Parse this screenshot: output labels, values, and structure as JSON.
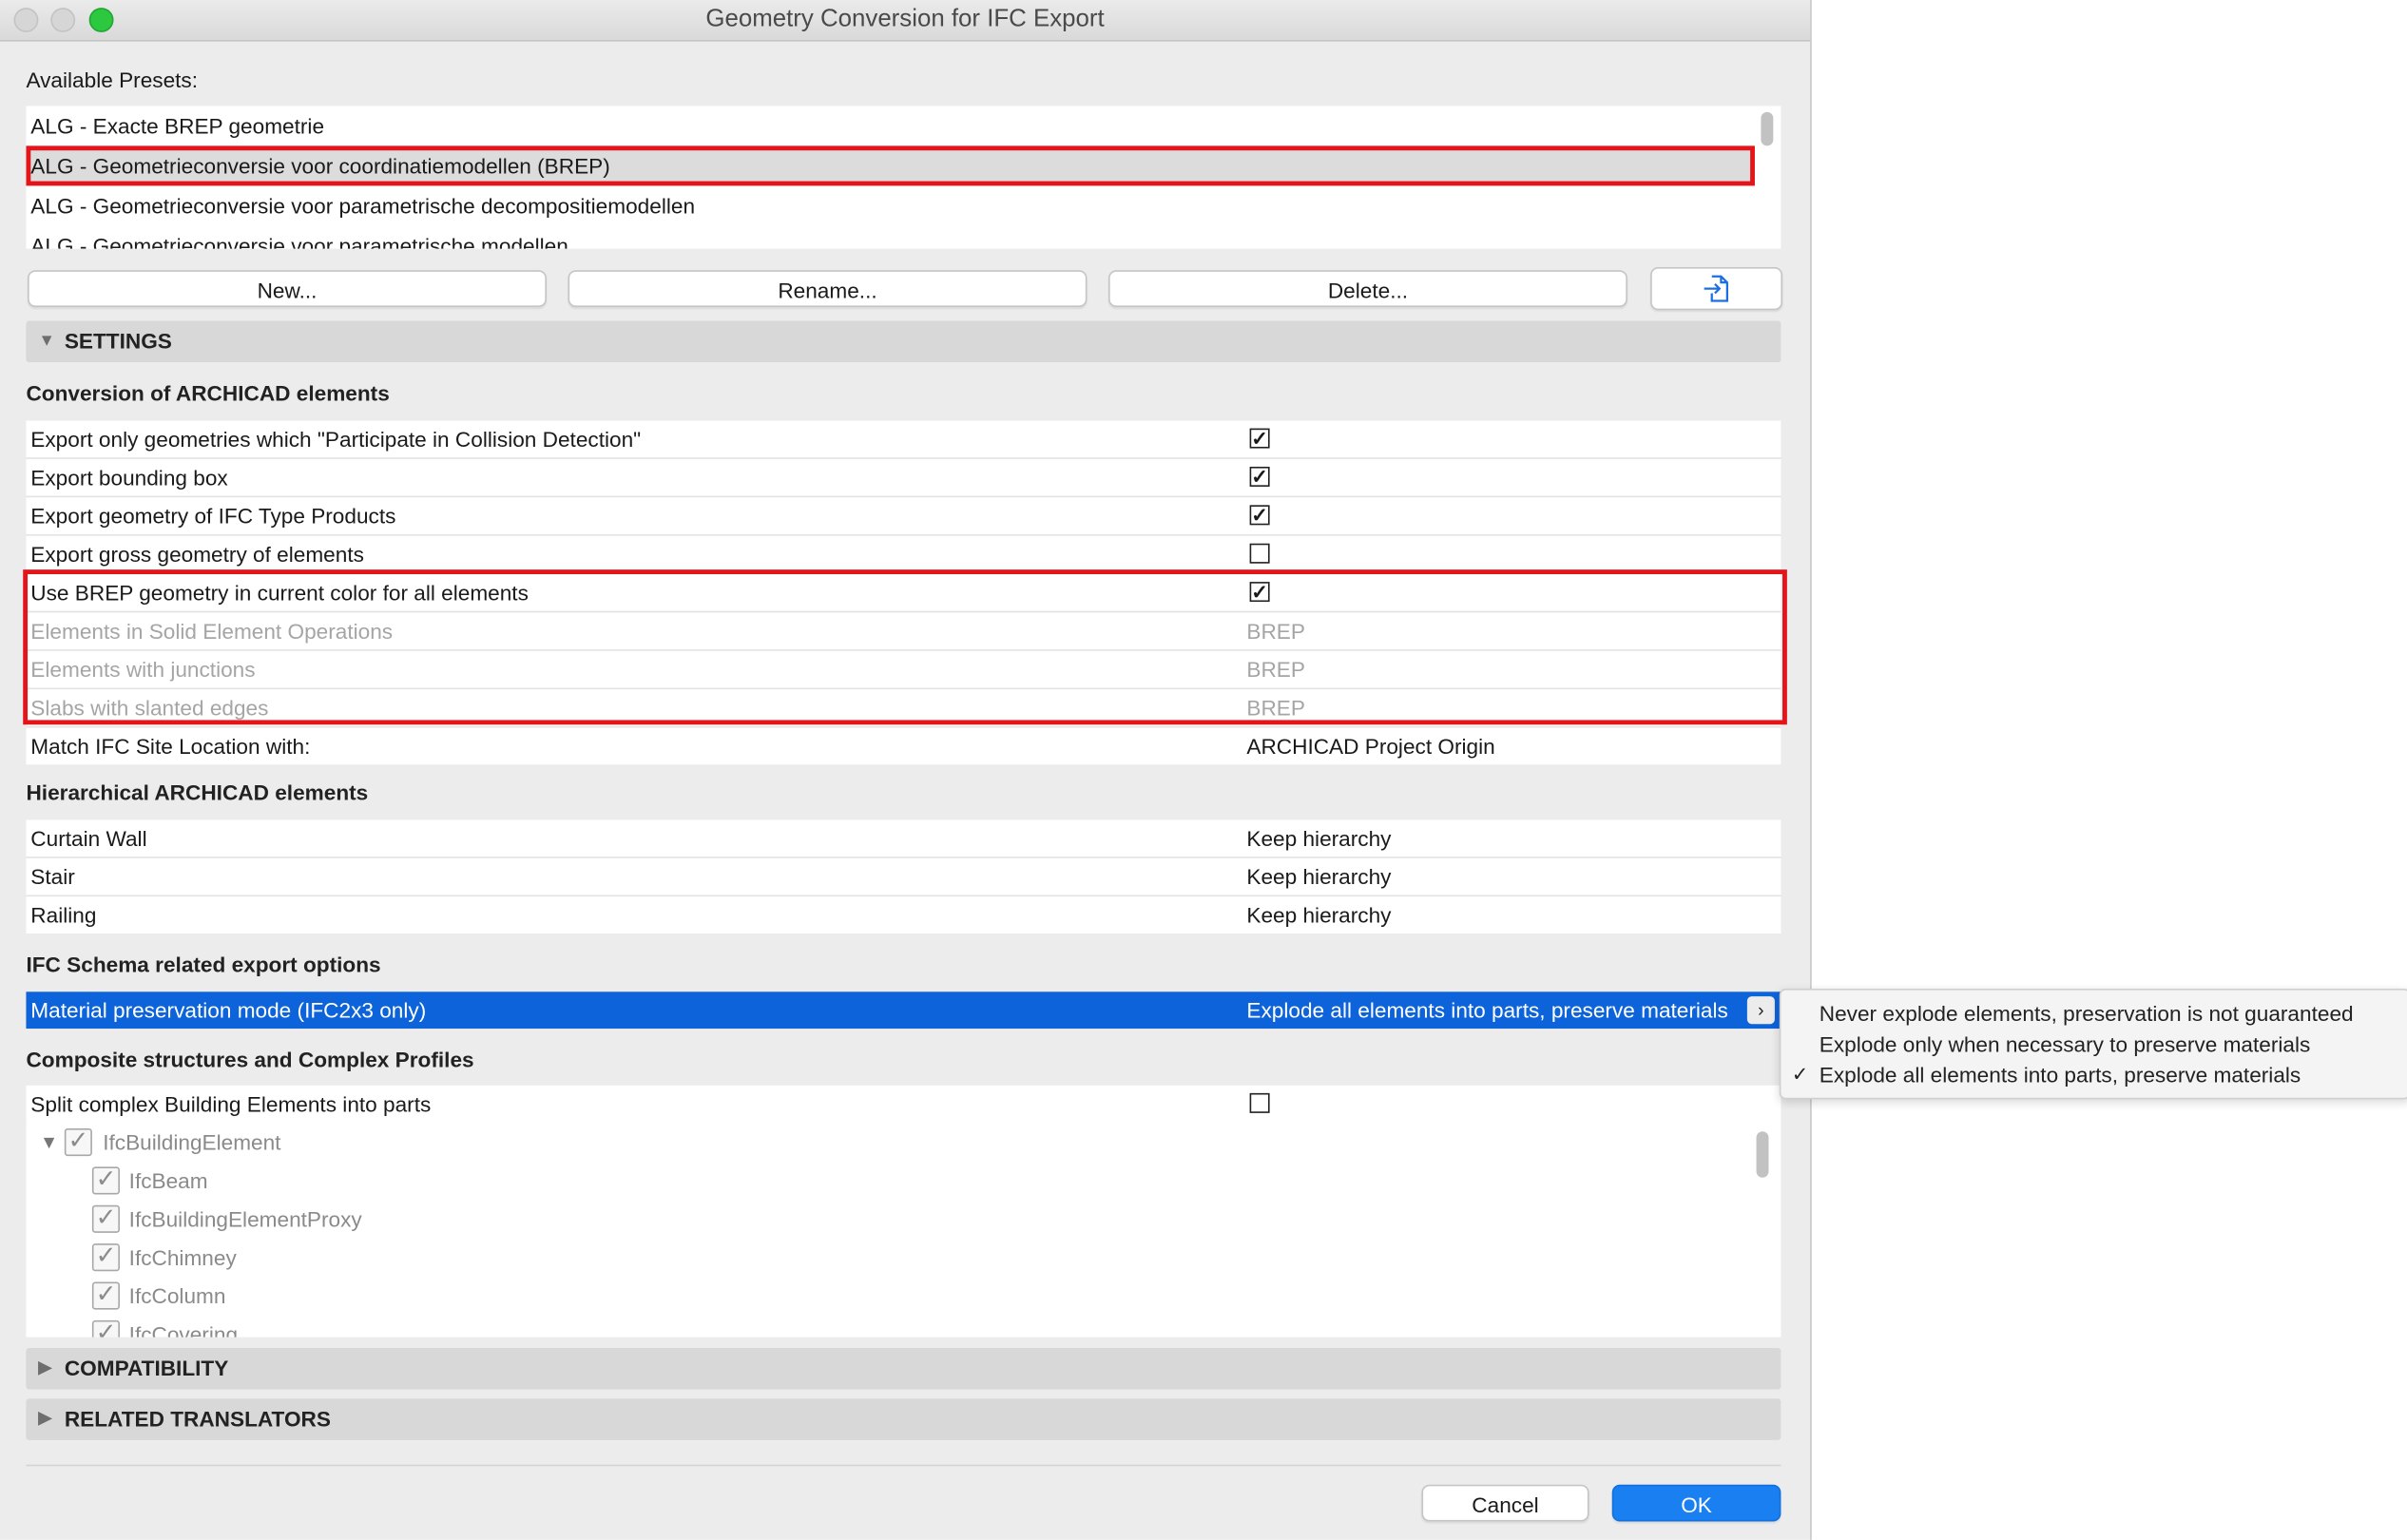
{
  "window": {
    "title": "Geometry Conversion for IFC Export"
  },
  "presets": {
    "label": "Available Presets:",
    "items": [
      "ALG - Exacte BREP geometrie",
      "ALG - Geometrieconversie voor coordinatiemodellen (BREP)",
      "ALG - Geometrieconversie voor parametrische decompositiemodellen",
      "ALG - Geometrieconversie voor parametrische modellen"
    ],
    "selected_index": 1
  },
  "buttons": {
    "new": "New...",
    "rename": "Rename...",
    "delete": "Delete...",
    "import_icon": "import-file-icon"
  },
  "sections": {
    "settings": "SETTINGS",
    "compatibility": "COMPATIBILITY",
    "related": "RELATED TRANSLATORS"
  },
  "conversion": {
    "title": "Conversion of ARCHICAD elements",
    "rows": [
      {
        "label": "Export only geometries which \"Participate in Collision Detection\"",
        "checked": true
      },
      {
        "label": "Export bounding box",
        "checked": true
      },
      {
        "label": "Export geometry of IFC Type Products",
        "checked": true
      },
      {
        "label": "Export gross geometry of elements",
        "checked": false
      },
      {
        "label": "Use BREP geometry in current color for all elements",
        "checked": true
      },
      {
        "label": "Elements in Solid Element Operations",
        "value": "BREP"
      },
      {
        "label": "Elements with junctions",
        "value": "BREP"
      },
      {
        "label": "Slabs with slanted edges",
        "value": "BREP"
      },
      {
        "label": "Match IFC Site Location with:",
        "value": "ARCHICAD Project Origin"
      }
    ]
  },
  "hierarchical": {
    "title": "Hierarchical ARCHICAD elements",
    "rows": [
      {
        "label": "Curtain Wall",
        "value": "Keep hierarchy"
      },
      {
        "label": "Stair",
        "value": "Keep hierarchy"
      },
      {
        "label": "Railing",
        "value": "Keep hierarchy"
      }
    ]
  },
  "schema": {
    "title": "IFC Schema related export options",
    "row": {
      "label": "Material preservation mode (IFC2x3 only)",
      "value": "Explode all elements into parts, preserve materials"
    }
  },
  "composite": {
    "title": "Composite structures and Complex Profiles",
    "split_label": "Split complex Building Elements into parts",
    "split_checked": false,
    "tree": [
      "IfcBuildingElement",
      "IfcBeam",
      "IfcBuildingElementProxy",
      "IfcChimney",
      "IfcColumn",
      "IfcCovering"
    ]
  },
  "popup": {
    "options": [
      "Never explode elements, preservation is not guaranteed",
      "Explode only when necessary to preserve materials",
      "Explode all elements into parts, preserve materials"
    ],
    "checked_index": 2
  },
  "footer": {
    "cancel": "Cancel",
    "ok": "OK"
  },
  "colors": {
    "accent": "#0d63d9",
    "highlight_border": "#e4141b",
    "ok_button": "#1a7ff0"
  }
}
